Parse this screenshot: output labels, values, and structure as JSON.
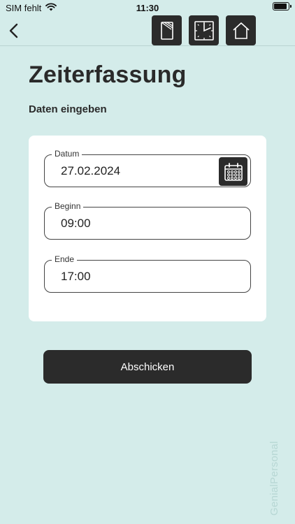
{
  "status_bar": {
    "carrier": "SIM fehlt",
    "time": "11:30",
    "battery_icon": "battery-full-icon",
    "wifi_icon": "wifi-icon"
  },
  "nav": {
    "back_icon": "chevron-left-icon",
    "buttons": [
      {
        "icon": "document-icon"
      },
      {
        "icon": "clock-icon"
      },
      {
        "icon": "home-icon"
      }
    ]
  },
  "page": {
    "title": "Zeiterfassung",
    "subtitle": "Daten eingeben"
  },
  "form": {
    "date": {
      "label": "Datum",
      "value": "27.02.2024",
      "icon": "calendar-icon"
    },
    "start": {
      "label": "Beginn",
      "value": "09:00"
    },
    "end": {
      "label": "Ende",
      "value": "17:00"
    }
  },
  "submit_label": "Abschicken",
  "watermark": "GenialPersonal",
  "colors": {
    "background": "#d4ecea",
    "dark_button": "#2b2b2b",
    "card": "#ffffff",
    "watermark": "#b7d7d4"
  }
}
